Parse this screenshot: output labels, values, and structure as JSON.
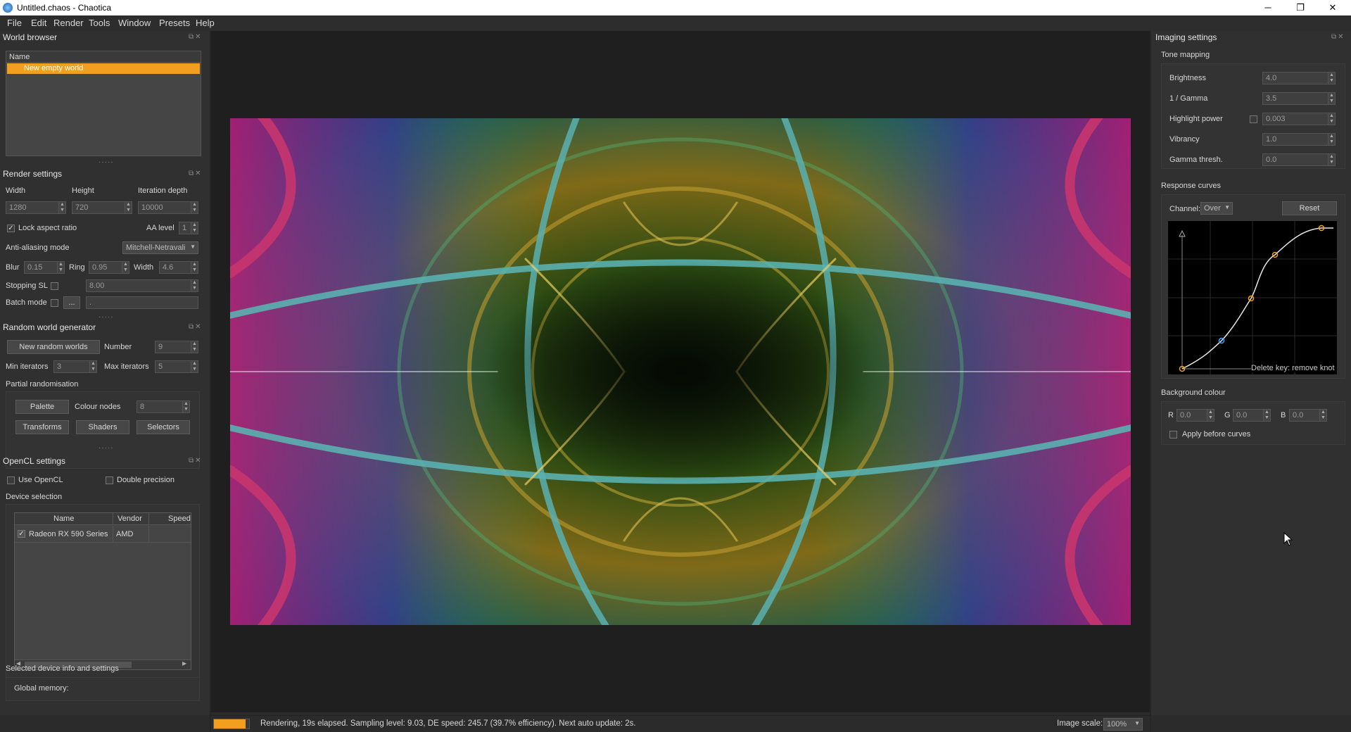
{
  "window": {
    "title": "Untitled.chaos - Chaotica",
    "minimize": "─",
    "maximize": "❐",
    "close": "✕"
  },
  "menu": [
    "File",
    "Edit",
    "Render",
    "Tools",
    "Window",
    "Presets",
    "Help"
  ],
  "world_browser": {
    "title": "World browser",
    "column": "Name",
    "items": [
      "New empty world"
    ]
  },
  "render_settings": {
    "title": "Render settings",
    "width_label": "Width",
    "height_label": "Height",
    "depth_label": "Iteration depth",
    "width": "1280",
    "height": "720",
    "depth": "10000",
    "lock_aspect": "Lock aspect ratio",
    "aa_level_label": "AA level",
    "aa_level": "1",
    "aa_mode_label": "Anti-aliasing mode",
    "aa_mode": "Mitchell-Netravali",
    "blur_label": "Blur",
    "blur": "0.15",
    "ring_label": "Ring",
    "ring": "0.95",
    "fwidth_label": "Width",
    "fwidth": "4.6",
    "stopping_label": "Stopping SL",
    "stopping": "8.00",
    "batch_label": "Batch mode",
    "batch_btn": "...",
    "batch_path": "."
  },
  "random_gen": {
    "title": "Random world generator",
    "new_btn": "New random worlds",
    "number_label": "Number",
    "number": "9",
    "min_label": "Min iterators",
    "min": "3",
    "max_label": "Max iterators",
    "max": "5",
    "partial_label": "Partial randomisation",
    "palette_btn": "Palette",
    "colour_nodes_label": "Colour nodes",
    "colour_nodes": "8",
    "transforms_btn": "Transforms",
    "shaders_btn": "Shaders",
    "selectors_btn": "Selectors"
  },
  "opencl": {
    "title": "OpenCL settings",
    "use_opencl": "Use OpenCL",
    "double_precision": "Double precision",
    "device_selection": "Device selection",
    "columns": [
      "Name",
      "Vendor",
      "Speed"
    ],
    "devices": [
      {
        "name": "Radeon RX 590 Series",
        "vendor": "AMD",
        "speed": ""
      }
    ],
    "selected_info": "Selected device info and settings",
    "global_memory": "Global memory:"
  },
  "imaging": {
    "title": "Imaging settings",
    "tone_mapping": "Tone mapping",
    "brightness_label": "Brightness",
    "brightness": "4.0",
    "gamma_label": "1 / Gamma",
    "gamma": "3.5",
    "highlight_label": "Highlight power",
    "highlight": "0.003",
    "vibrancy_label": "Vibrancy",
    "vibrancy": "1.0",
    "gamma_thresh_label": "Gamma thresh.",
    "gamma_thresh": "0.0",
    "response_curves": "Response curves",
    "channel_label": "Channel:",
    "channel": "Over",
    "reset_btn": "Reset",
    "curve_hint": "Delete key: remove knot",
    "background_colour": "Background colour",
    "r_label": "R",
    "r": "0.0",
    "g_label": "G",
    "g": "0.0",
    "b_label": "B",
    "b": "0.0",
    "apply_before": "Apply before curves"
  },
  "status": {
    "text": "Rendering, 19s elapsed. Sampling level: 9.03, DE speed: 245.7 (39.7% efficiency). Next auto update: 2s.",
    "progress": 0.9,
    "image_scale_label": "Image scale:",
    "image_scale": "100%"
  },
  "colors": {
    "accent": "#f0a01e",
    "panel": "#303030",
    "view": "#1f1f1f"
  }
}
